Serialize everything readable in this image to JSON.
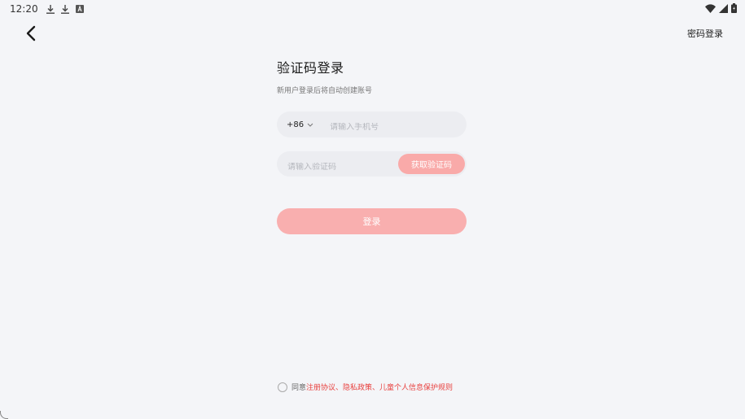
{
  "status_bar": {
    "time": "12:20",
    "left_icons": [
      "download-icon",
      "download-icon",
      "text-a-icon"
    ],
    "right_icons": [
      "wifi-icon",
      "cellular-signal-icon",
      "battery-icon"
    ]
  },
  "nav": {
    "back_icon": "chevron-left-icon",
    "password_login_label": "密码登录"
  },
  "form": {
    "title": "验证码登录",
    "subtitle": "新用户登录后将自动创建账号",
    "country_code": "+86",
    "phone_placeholder": "请输入手机号",
    "code_placeholder": "请输入验证码",
    "get_code_label": "获取验证码",
    "login_label": "登录"
  },
  "agreement": {
    "prefix": "同意",
    "links": "注册协议、隐私政策、儿童个人信息保护规则"
  },
  "colors": {
    "background": "#f4f5f8",
    "field_background": "#ecedf1",
    "button_pink": "#f9aaa9",
    "link_red": "#e8413f"
  }
}
